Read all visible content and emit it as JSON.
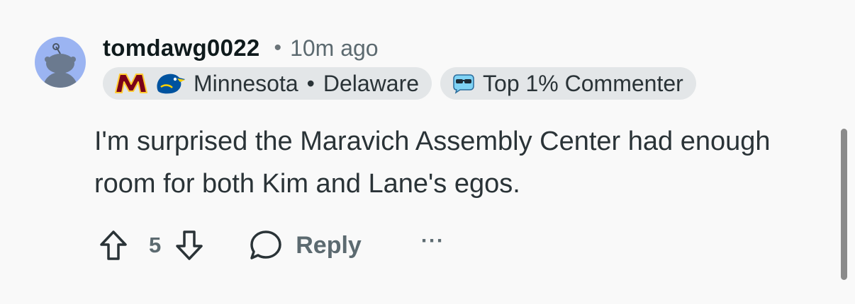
{
  "comment": {
    "author": "tomdawg0022",
    "separator": "•",
    "timestamp": "10m ago",
    "flair_teams": {
      "team1": "Minnesota",
      "separator": "•",
      "team2": "Delaware",
      "icons": [
        "minnesota-m-icon",
        "delaware-blue-hen-icon"
      ]
    },
    "flair_badge": {
      "label": "Top 1% Commenter",
      "icon": "top-commenter-icon"
    },
    "body": "I'm surprised the Maravich Assembly Center had enough room for both Kim and Lane's egos.",
    "vote_count": "5",
    "reply_label": "Reply",
    "more_label": "···"
  },
  "colors": {
    "background": "#f9f9f9",
    "avatar": "#9bb4f2",
    "flair_bg": "#e3e6e8",
    "meta_text": "#5c6a70",
    "minnesota_maroon": "#7a0019",
    "minnesota_gold": "#ffcc33",
    "delaware_blue": "#00539f"
  }
}
